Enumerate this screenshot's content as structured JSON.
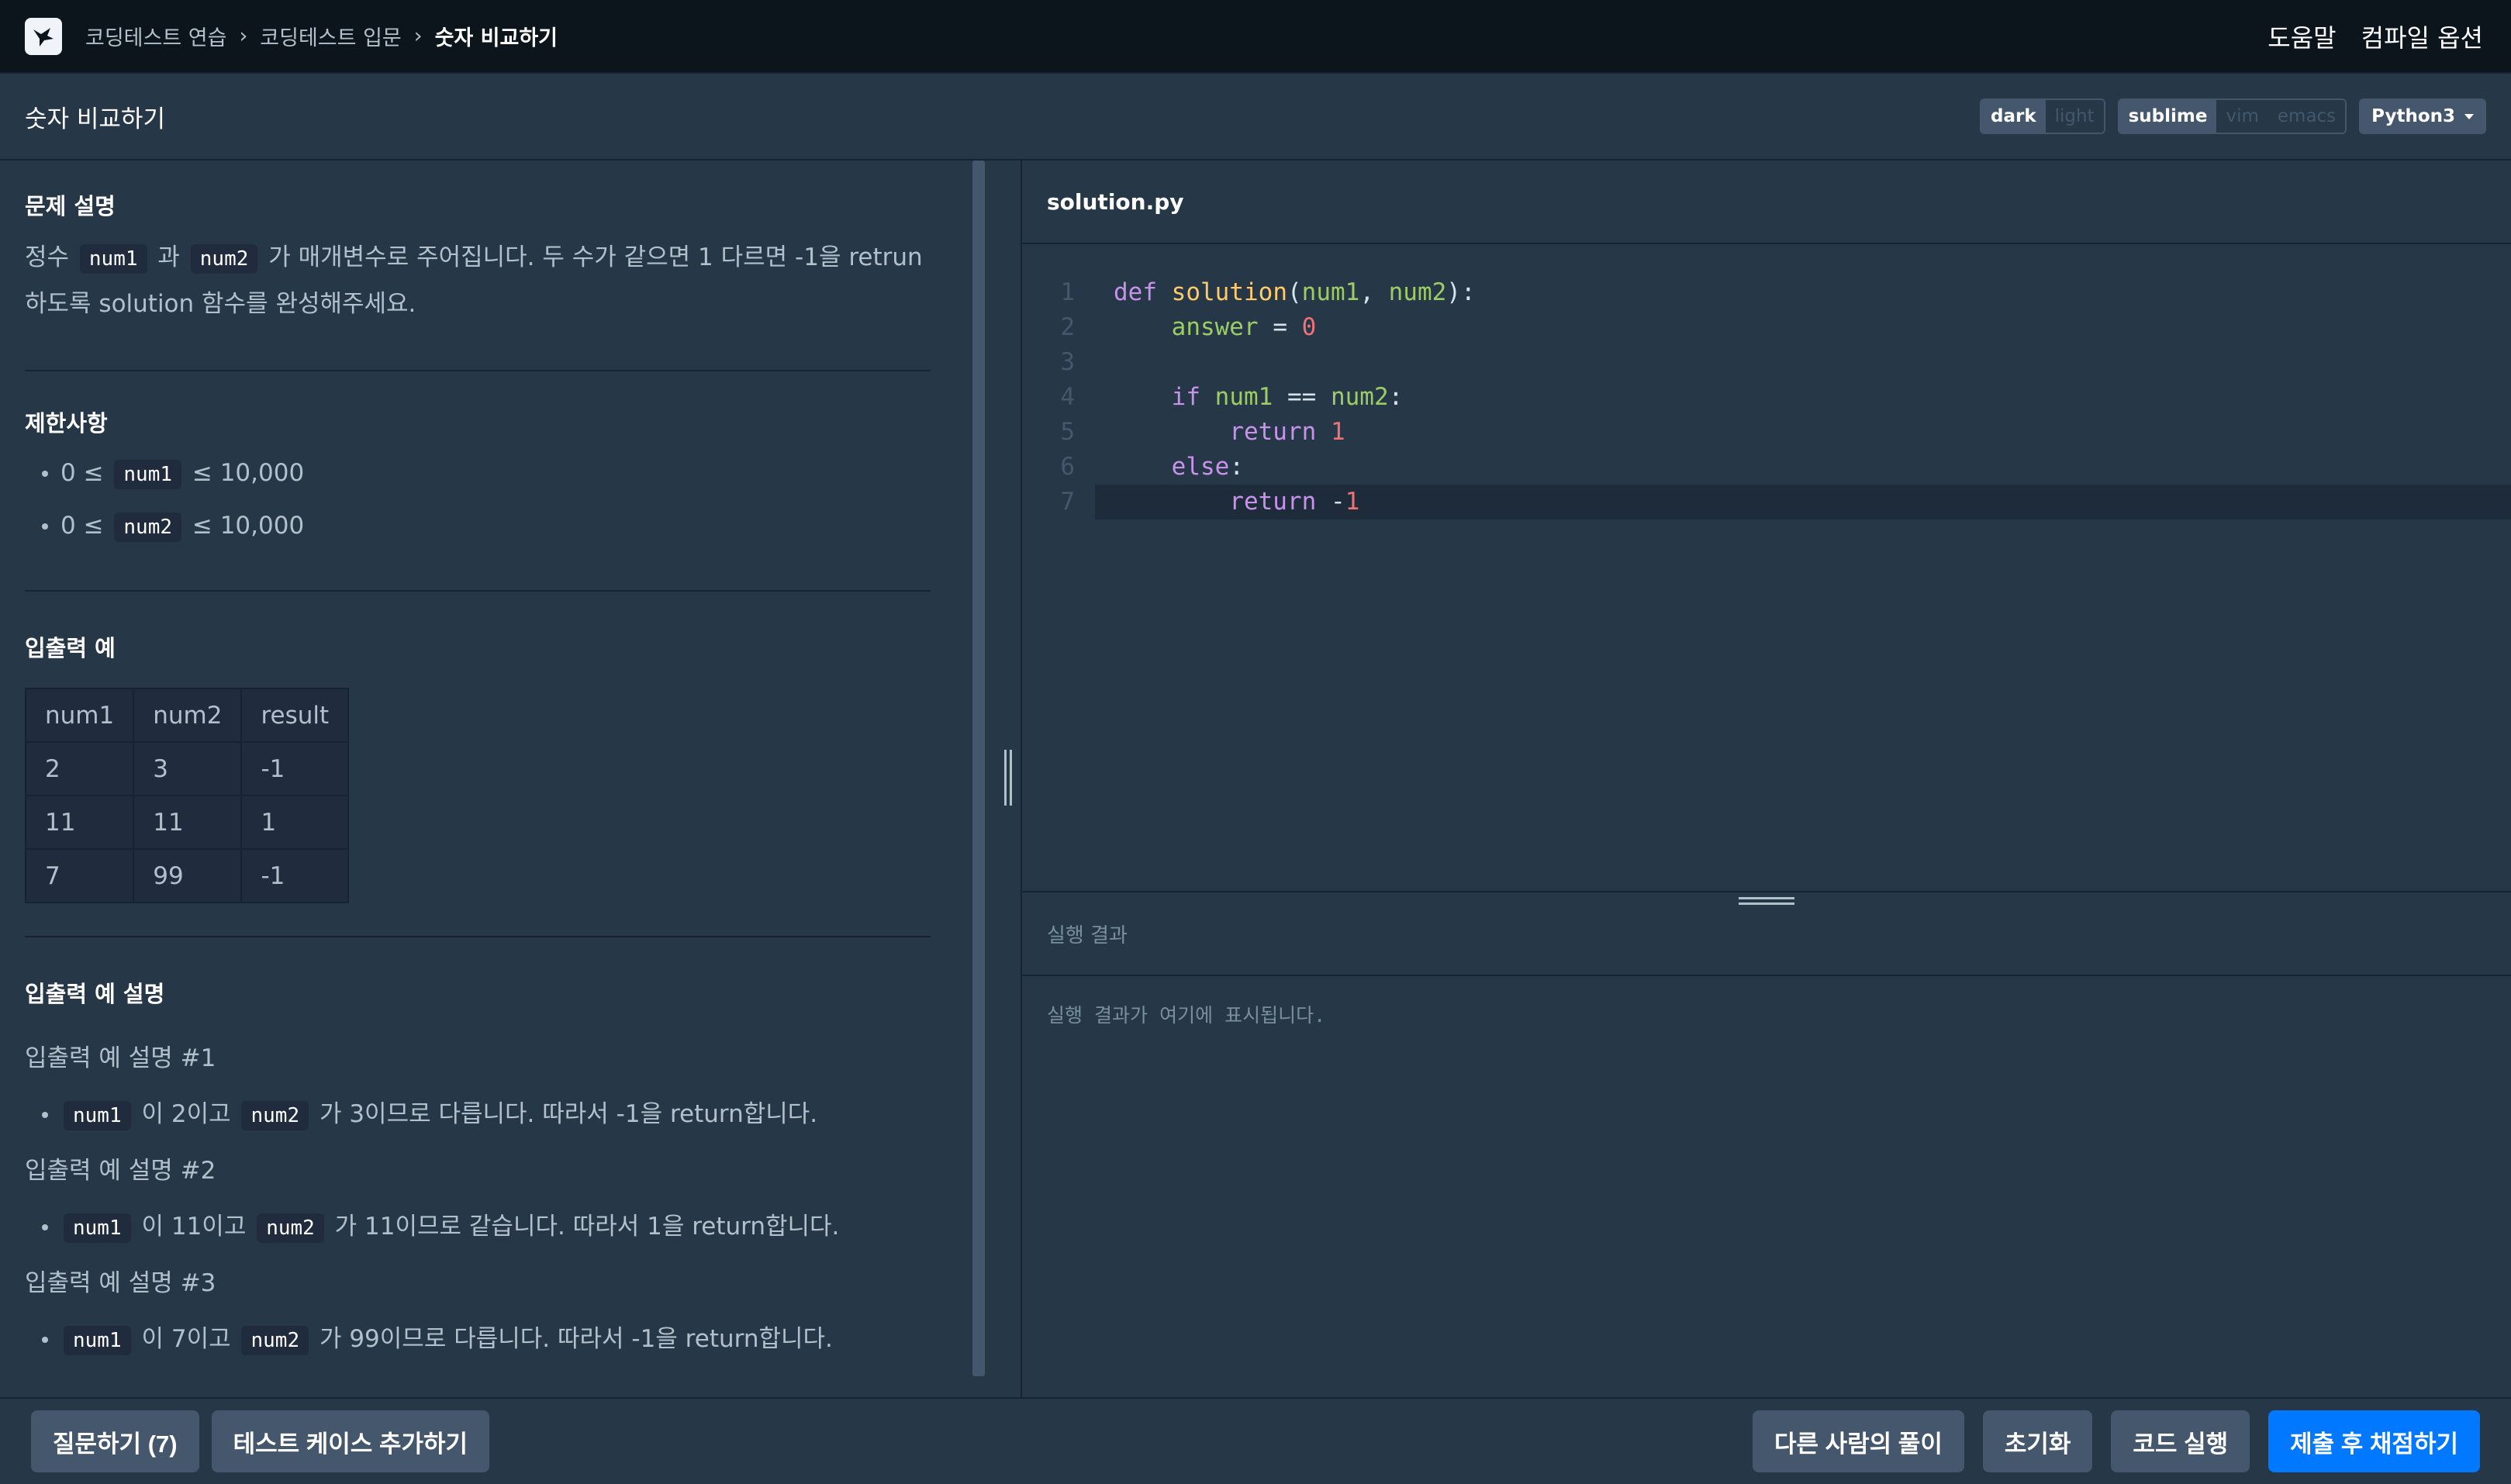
{
  "nav": {
    "breadcrumbs": [
      "코딩테스트 연습",
      "코딩테스트 입문",
      "숫자 비교하기"
    ],
    "right_links": [
      "도움말",
      "컴파일 옵션"
    ]
  },
  "titlebar": {
    "title": "숫자 비교하기",
    "theme_options": [
      "dark",
      "light"
    ],
    "theme_selected": "dark",
    "keymap_options": [
      "sublime",
      "vim",
      "emacs"
    ],
    "keymap_selected": "sublime",
    "language": "Python3"
  },
  "problem": {
    "desc_title": "문제 설명",
    "desc_parts": [
      "정수 ",
      "num1",
      " 과 ",
      "num2",
      " 가 매개변수로 주어집니다. 두 수가 같으면 1 다르면 -1을 retrun하도록 solution 함수를 완성해주세요."
    ],
    "limit_title": "제한사항",
    "limits": [
      {
        "pre": "0 ≤ ",
        "code": "num1",
        "post": " ≤ 10,000"
      },
      {
        "pre": "0 ≤ ",
        "code": "num2",
        "post": " ≤ 10,000"
      }
    ],
    "io_title": "입출력 예",
    "io_headers": [
      "num1",
      "num2",
      "result"
    ],
    "io_rows": [
      [
        "2",
        "3",
        "-1"
      ],
      [
        "11",
        "11",
        "1"
      ],
      [
        "7",
        "99",
        "-1"
      ]
    ],
    "explain_title": "입출력 예 설명",
    "explains": [
      {
        "title": "입출력 예 설명 #1",
        "a": "num1",
        "mid": " 이 2이고 ",
        "b": "num2",
        "post": " 가 3이므로 다릅니다. 따라서 -1을 return합니다."
      },
      {
        "title": "입출력 예 설명 #2",
        "a": "num1",
        "mid": " 이 11이고 ",
        "b": "num2",
        "post": " 가 11이므로 같습니다. 따라서 1을 return합니다."
      },
      {
        "title": "입출력 예 설명 #3",
        "a": "num1",
        "mid": " 이 7이고 ",
        "b": "num2",
        "post": " 가 99이므로 다릅니다. 따라서 -1을 return합니다."
      }
    ]
  },
  "editor": {
    "file_name": "solution.py",
    "line_numbers": [
      "1",
      "2",
      "3",
      "4",
      "5",
      "6",
      "7"
    ],
    "active_line": 7
  },
  "result": {
    "title": "실행 결과",
    "placeholder": "실행 결과가 여기에 표시됩니다."
  },
  "footer": {
    "question_button": "질문하기 (7)",
    "add_testcase_button": "테스트 케이스 추가하기",
    "others_solution_button": "다른 사람의 풀이",
    "reset_button": "초기화",
    "run_button": "코드 실행",
    "submit_button": "제출 후 채점하기"
  },
  "colors": {
    "background": "#263747",
    "nav": "#0c151c",
    "primary": "#0078ff"
  }
}
